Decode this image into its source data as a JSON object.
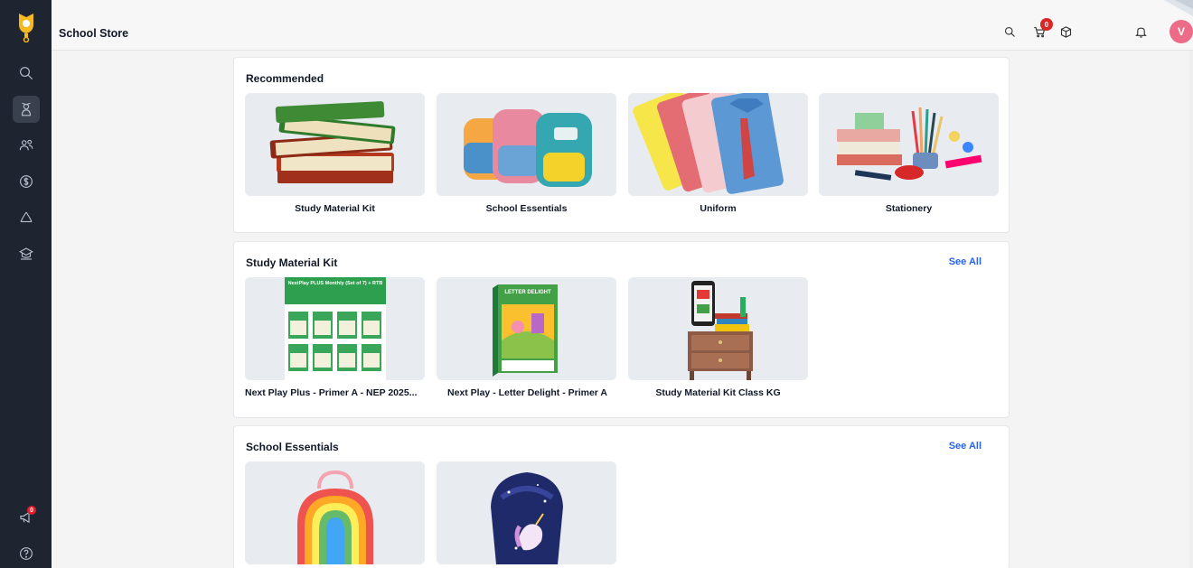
{
  "app": {
    "title": "School Store"
  },
  "topbar": {
    "cart_count": "0",
    "avatar_initial": "V"
  },
  "sidebar": {
    "announcement_badge": "0"
  },
  "sections": {
    "recommended": {
      "title": "Recommended",
      "items": [
        {
          "label": "Study Material Kit"
        },
        {
          "label": "School Essentials"
        },
        {
          "label": "Uniform"
        },
        {
          "label": "Stationery"
        }
      ]
    },
    "study_material_kit": {
      "title": "Study Material Kit",
      "see_all": "See All",
      "items": [
        {
          "label": "Next Play Plus - Primer A - NEP 2025...",
          "cover_title": "NestPlay PLUS Monthly (Set of 7) + RTB"
        },
        {
          "label": "Next Play - Letter Delight - Primer A",
          "cover_title": "LETTER DELIGHT"
        },
        {
          "label": "Study Material Kit Class KG"
        }
      ]
    },
    "school_essentials": {
      "title": "School Essentials",
      "see_all": "See All",
      "items": [
        {
          "label": ""
        },
        {
          "label": ""
        }
      ]
    }
  },
  "colors": {
    "sidebar_bg": "#1f2530",
    "link": "#2563eb",
    "badge": "#dc2626",
    "avatar": "#ec6b86"
  }
}
